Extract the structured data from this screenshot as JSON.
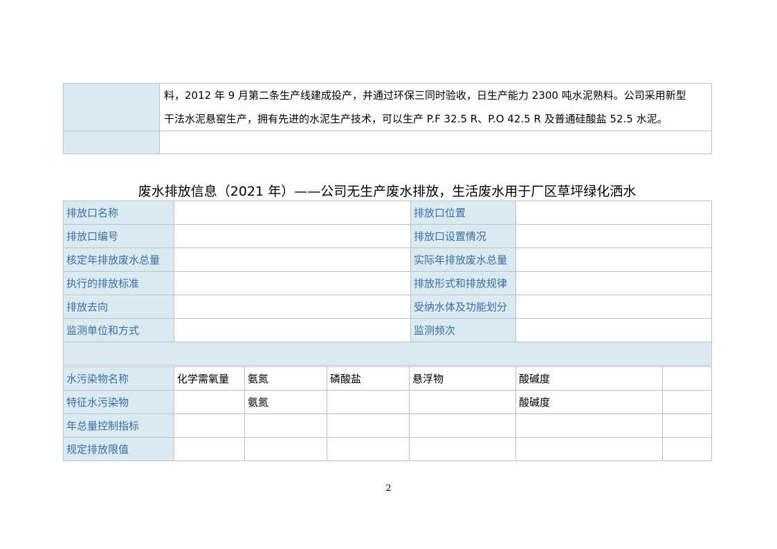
{
  "top_table": {
    "line1": "料，2012 年 9 月第二条生产线建成投产，并通过环保三同时验收，日生产能力 2300 吨水泥熟料。公司采用新型",
    "line2": "干法水泥悬窑生产，拥有先进的水泥生产技术，可以生产 P.F 32.5 R、P.O 42.5 R 及普通硅酸盐 52.5 水泥。"
  },
  "section_title": "废水排放信息（2021 年）——公司无生产废水排放，生活废水用于厂区草坪绿化洒水",
  "info_rows": [
    {
      "left_label": "排放口名称",
      "right_label": "排放口位置"
    },
    {
      "left_label": "排放口编号",
      "right_label": "排放口设置情况"
    },
    {
      "left_label": "核定年排放废水总量",
      "right_label": "实际年排放废水总量"
    },
    {
      "left_label": "执行的排放标准",
      "right_label": "排放形式和排放规律"
    },
    {
      "left_label": "排放去向",
      "right_label": "受纳水体及功能划分"
    },
    {
      "left_label": "监测单位和方式",
      "right_label": "监测频次"
    }
  ],
  "pollutant_table": {
    "rows": [
      {
        "label": "水污染物名称",
        "cells": [
          "化学需氧量",
          "氨氮",
          "磷酸盐",
          "悬浮物",
          "酸碱度",
          ""
        ]
      },
      {
        "label": "特征水污染物",
        "cells": [
          "",
          "氨氮",
          "",
          "",
          "酸碱度",
          ""
        ]
      },
      {
        "label": "年总量控制指标",
        "cells": [
          "",
          "",
          "",
          "",
          "",
          ""
        ]
      },
      {
        "label": "规定排放限值",
        "cells": [
          "",
          "",
          "",
          "",
          "",
          ""
        ]
      }
    ]
  },
  "page_number": "2"
}
